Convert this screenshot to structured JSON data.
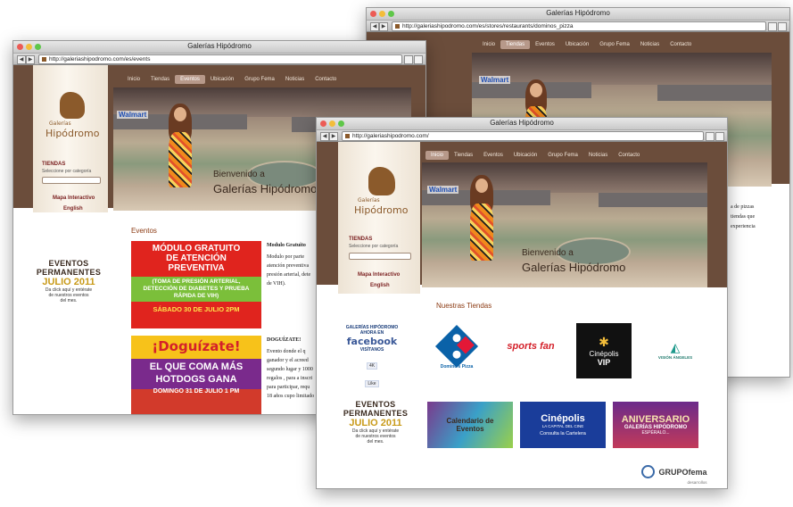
{
  "windows": {
    "back": {
      "title": "Galerías Hipódromo",
      "url": "http://galeriashipodromo.com/es/stores/restaurants/dominos_pizza",
      "nav": [
        "Inicio",
        "Tiendas",
        "Eventos",
        "Ubicación",
        "Grupo Fema",
        "Noticias",
        "Contacto"
      ],
      "active_nav": "Tiendas",
      "text_lines": [
        "a de pizzas",
        "tiendas que",
        "experiencia"
      ]
    },
    "left": {
      "title": "Galerías Hipódromo",
      "url": "http://galeriashipodromo.com/es/events",
      "nav": [
        "Inicio",
        "Tiendas",
        "Eventos",
        "Ubicación",
        "Grupo Fema",
        "Noticias",
        "Contacto"
      ],
      "active_nav": "Eventos",
      "section_title": "Eventos",
      "event1": {
        "banner_lines": [
          "MÓDULO GRATUITO",
          "DE ATENCIÓN",
          "PREVENTIVA"
        ],
        "banner_sub": [
          "(TOMA DE PRESIÓN ARTERIAL,",
          "DETECCIÓN DE DIABETES Y PRUEBA",
          "RÁPIDA DE VIH)"
        ],
        "banner_date": "SÁBADO 30 DE JULIO 2PM",
        "heading": "Modulo Gratuito",
        "text": [
          "Modulo por parte",
          "atención preventiva",
          "presión arterial, dete",
          "de VIH)."
        ]
      },
      "event2": {
        "banner_title": "¡Doguízate!",
        "banner_lines": [
          "EL QUE COMA MÁS",
          "HOTDOGS GANA"
        ],
        "banner_date": "DOMINGO 31 DE JULIO 1 PM",
        "heading": "DOGUÍZATE!",
        "text": [
          "Evento donde el q",
          "ganador y el acreed",
          "segundo lugar y 1000",
          "regalos , para a inscri",
          "para participar, requ",
          "18 años cupo limitado"
        ]
      }
    },
    "front": {
      "title": "Galerías Hipódromo",
      "url": "http://galeriashipodromo.com/",
      "nav": [
        "Inicio",
        "Tiendas",
        "Eventos",
        "Ubicación",
        "Grupo Fema",
        "Noticias",
        "Contacto"
      ],
      "active_nav": "Inicio",
      "welcome_1": "Bienvenido a",
      "welcome_2": "Galerías Hipódromo",
      "section_title": "Nuestras Tiendas",
      "facebook": {
        "line1": "GALERÍAS HIPÓDROMO",
        "line2": "AHORA EN",
        "name": "facebook",
        "line3": "VISÍTANOS",
        "likes": "4K",
        "like_label": "Like"
      },
      "stores": [
        {
          "name": "Domino's Pizza"
        },
        {
          "name": "sports fan"
        },
        {
          "name": "Cinépolis",
          "sub": "VIP"
        },
        {
          "name": "VISIÓN ÁNGELES"
        }
      ],
      "promos": [
        {
          "name": "Calendario de Eventos"
        },
        {
          "name": "Cinépolis",
          "sub": "LA CAPITAL DEL CINE",
          "sub2": "Consulta la Cartelera"
        },
        {
          "name": "ANIVERSARIO",
          "sub": "GALERÍAS HIPÓDROMO",
          "sub2": "ESPÉRALO..."
        }
      ],
      "footer_logo": "GRUPOfema",
      "footer_sub": "desarrollos"
    }
  },
  "shared": {
    "logo_word1": "Galerías",
    "logo_word2": "Hipódromo",
    "tiendas_label": "TIENDAS",
    "select_label": "Seleccione por categoría",
    "mapa_label": "Mapa Interactivo",
    "english_label": "English",
    "walmart": "Walmart",
    "eventos_box": {
      "line1": "EVENTOS",
      "line2": "PERMANENTES",
      "line3": "JULIO 2011",
      "line4": "Da click aquí y entérate",
      "line5": "de nuestros eventos",
      "line6": "del mes."
    }
  },
  "colors": {
    "brand_brown": "#6b4d3b",
    "accent_red": "#7a1f1f",
    "gold": "#c89a19"
  }
}
